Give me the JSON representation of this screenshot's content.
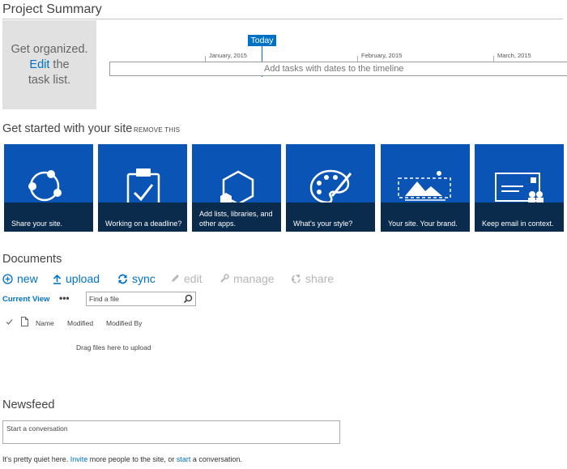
{
  "project_summary": {
    "title": "Project Summary",
    "organize": {
      "line1": "Get organized.",
      "link": "Edit",
      "after_link": " the",
      "line3": "task list."
    },
    "today_label": "Today",
    "months": [
      "January, 2015",
      "February, 2015",
      "March, 2015"
    ],
    "timeline_placeholder": "Add tasks with dates to the timeline"
  },
  "get_started": {
    "title": "Get started with your site",
    "remove_label": "REMOVE THIS",
    "tiles": [
      {
        "caption": "Share your site.",
        "icon": "share-icon"
      },
      {
        "caption": "Working on a deadline?",
        "icon": "clipboard-check-icon"
      },
      {
        "caption": "Add lists, libraries, and other apps.",
        "icon": "hexagon-apps-icon"
      },
      {
        "caption": "What's your style?",
        "icon": "palette-icon"
      },
      {
        "caption": "Your site. Your brand.",
        "icon": "landscape-image-icon"
      },
      {
        "caption": "Keep email in context.",
        "icon": "contact-card-icon"
      }
    ]
  },
  "documents": {
    "title": "Documents",
    "commands": {
      "new": "new",
      "upload": "upload",
      "sync": "sync",
      "edit": "edit",
      "manage": "manage",
      "share": "share"
    },
    "current_view": "Current View",
    "more": "•••",
    "search_placeholder": "Find a file",
    "columns": {
      "name": "Name",
      "modified": "Modified",
      "modified_by": "Modified By"
    },
    "empty_text": "Drag files here to upload"
  },
  "newsfeed": {
    "title": "Newsfeed",
    "conversation_placeholder": "Start a conversation",
    "quiet": {
      "part1": "It's pretty quiet here. ",
      "invite": "Invite",
      "part2": " more people to the site, or ",
      "start": "start",
      "part3": " a conversation."
    }
  },
  "colors": {
    "accent": "#0072c6",
    "tile": "#0a54b5",
    "tile_caption": "#0b2b4d"
  }
}
